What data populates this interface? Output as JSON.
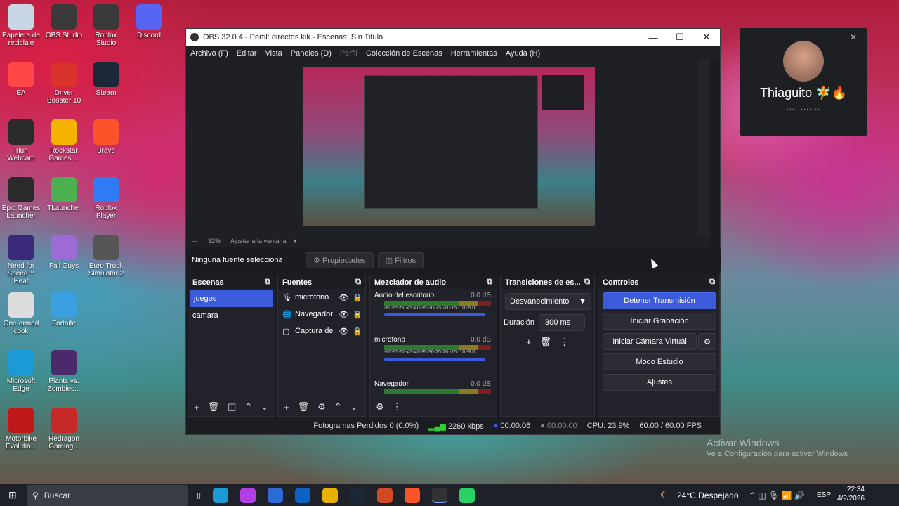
{
  "desktop": [
    {
      "label": "Papelera de reciclaje",
      "icon": "recycle-bin-icon",
      "color": "#c8d6e6"
    },
    {
      "label": "OBS Studio",
      "icon": "obs-icon",
      "color": "#3a3a3a"
    },
    {
      "label": "Roblox Studio",
      "icon": "roblox-studio-icon",
      "color": "#3a3a3a"
    },
    {
      "label": "Discord",
      "icon": "discord-icon",
      "color": "#5865f2"
    },
    {
      "label": "EA",
      "icon": "ea-icon",
      "color": "#ff4747"
    },
    {
      "label": "Driver Booster 10",
      "icon": "driver-booster-icon",
      "color": "#d9312b"
    },
    {
      "label": "Steam",
      "icon": "steam-icon",
      "color": "#1b2838"
    },
    {
      "label": "Iriun Webcam",
      "icon": "iriun-icon",
      "color": "#2b2b2b"
    },
    {
      "label": "Rockstar Games ...",
      "icon": "rockstar-icon",
      "color": "#f5b300"
    },
    {
      "label": "Brave",
      "icon": "brave-icon",
      "color": "#fb542b"
    },
    {
      "label": "Epic Games Launcher",
      "icon": "epic-icon",
      "color": "#2a2a2a"
    },
    {
      "label": "TLauncher",
      "icon": "tlauncher-icon",
      "color": "#4caf50"
    },
    {
      "label": "Roblox Player",
      "icon": "roblox-icon",
      "color": "#2f7bf5"
    },
    {
      "label": "Need for Speed™ Heat",
      "icon": "nfs-icon",
      "color": "#3b2a7a"
    },
    {
      "label": "Fall Guys",
      "icon": "fallguys-icon",
      "color": "#9c6bd6"
    },
    {
      "label": "Euro Truck Simulator 2",
      "icon": "ets2-icon",
      "color": "#555"
    },
    {
      "label": "One-armed cook",
      "icon": "cook-icon",
      "color": "#dddddd"
    },
    {
      "label": "Fortnite",
      "icon": "fortnite-icon",
      "color": "#3aa0e0"
    },
    {
      "label": "Microsoft Edge",
      "icon": "edge-icon",
      "color": "#1b9ad6"
    },
    {
      "label": "Plants vs. Zombies...",
      "icon": "pvz-icon",
      "color": "#4a2a6a"
    },
    {
      "label": "Motorbike Evolutio...",
      "icon": "motorbike-icon",
      "color": "#c01818"
    },
    {
      "label": "Redragon Gaming...",
      "icon": "redragon-icon",
      "color": "#c62828"
    }
  ],
  "obs": {
    "title": "OBS 32.0.4 - Perfil: directos kik - Escenas: Sin Titulo",
    "menu": [
      "Archivo (F)",
      "Editar",
      "Vista",
      "Paneles (D)",
      "Perfil",
      "Colección de Escenas",
      "Herramientas",
      "Ayuda (H)"
    ],
    "zoom": "32%",
    "fit": "Ajustar a la ventana",
    "no_source": "Ninguna fuente seleccionac",
    "properties": "Propiedades",
    "filters": "Filtros",
    "scenes_title": "Escenas",
    "scenes": [
      "juegos",
      "camara"
    ],
    "sources_title": "Fuentes",
    "sources": [
      "microfono",
      "Navegador",
      "Captura de"
    ],
    "mixer_title": "Mezclador de audio",
    "mixer": [
      {
        "name": "Audio del escritorio",
        "db": "0.0 dB"
      },
      {
        "name": "microfono",
        "db": "0.0 dB"
      },
      {
        "name": "Navegador",
        "db": "0.0 dB"
      }
    ],
    "scale": "-60-55-50-45-40-35-30-25-20 -15 -10 -5 0",
    "transitions_title": "Transiciones de es...",
    "transition": "Desvanecimiento",
    "duration_label": "Duración",
    "duration": "300 ms",
    "controls_title": "Controles",
    "controls": {
      "stop": "Detener Transmisión",
      "record": "Iniciar Grabación",
      "vcam": "Iniciar Cámara Virtual",
      "studio": "Modo Estudio",
      "settings": "Ajustes"
    },
    "status": {
      "dropped": "Fotogramas Perdidos 0 (0.0%)",
      "bitrate": "2260 kbps",
      "stream_time": "00:00:06",
      "rec_time": "00:00:00",
      "cpu": "CPU: 23.9%",
      "fps": "60.00 / 60.00 FPS"
    }
  },
  "popup": {
    "name": "Thiaguito 🧚🔥",
    "dots": "............"
  },
  "watermark": {
    "line1": "Activar Windows",
    "line2": "Ve a Configuración para activar Windows"
  },
  "taskbar": {
    "search": "Buscar",
    "weather": "24°C  Despejado",
    "lang": "ESP",
    "time": "22:34",
    "date": "4/2/2026"
  },
  "accent": "#3b5bdb"
}
